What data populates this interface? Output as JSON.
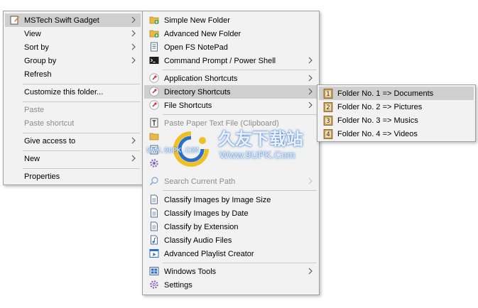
{
  "main_menu": {
    "items": [
      {
        "label": "MSTech Swift Gadget"
      },
      {
        "label": "View"
      },
      {
        "label": "Sort by"
      },
      {
        "label": "Group by"
      },
      {
        "label": "Refresh"
      },
      {
        "label": "Customize this folder..."
      },
      {
        "label": "Paste"
      },
      {
        "label": "Paste shortcut"
      },
      {
        "label": "Give access to"
      },
      {
        "label": "New"
      },
      {
        "label": "Properties"
      }
    ]
  },
  "gadget_menu": {
    "items": [
      {
        "label": "Simple New Folder",
        "icon": "folder-add-icon"
      },
      {
        "label": "Advanced New Folder",
        "icon": "folder-add-icon"
      },
      {
        "label": "Open FS NotePad",
        "icon": "notepad-icon"
      },
      {
        "label": "Command Prompt / Power Shell",
        "icon": "terminal-icon"
      },
      {
        "label": "Application Shortcuts",
        "icon": "pin-icon"
      },
      {
        "label": "Directory Shortcuts",
        "icon": "pin-icon"
      },
      {
        "label": "File Shortcuts",
        "icon": "pin-icon"
      },
      {
        "label": "Paste Paper Text File (Clipboard)",
        "icon": "text-file-icon"
      },
      {
        "label": "Search Current Path",
        "icon": "search-icon"
      },
      {
        "label": "Classify Images by Image Size",
        "icon": "document-icon"
      },
      {
        "label": "Classify Images by Date",
        "icon": "document-icon"
      },
      {
        "label": "Classify by Extension",
        "icon": "document-icon"
      },
      {
        "label": "Classify Audio Files",
        "icon": "audio-file-icon"
      },
      {
        "label": "Advanced Playlist Creator",
        "icon": "playlist-icon"
      },
      {
        "label": "Windows Tools",
        "icon": "windows-tools-icon"
      },
      {
        "label": "Settings",
        "icon": "gear-icon"
      }
    ]
  },
  "directory_shortcuts_menu": {
    "items": [
      {
        "label": "Folder No. 1 => Documents",
        "number": "1"
      },
      {
        "label": "Folder No. 2 => Pictures",
        "number": "2"
      },
      {
        "label": "Folder No. 3 => Musics",
        "number": "3"
      },
      {
        "label": "Folder No. 4 => Videos",
        "number": "4"
      }
    ]
  },
  "watermark": {
    "chinese_title": "久友下载站",
    "url_small": "WWW.9UPK.COM",
    "url_main": "Www.9UPK.Com"
  },
  "colors": {
    "menu_bg": "#f2f2f2",
    "highlight": "#cfcfcf",
    "disabled_text": "#8c8c8c",
    "accent_blue": "#2a6fc9",
    "pin_red": "#d9363e"
  }
}
